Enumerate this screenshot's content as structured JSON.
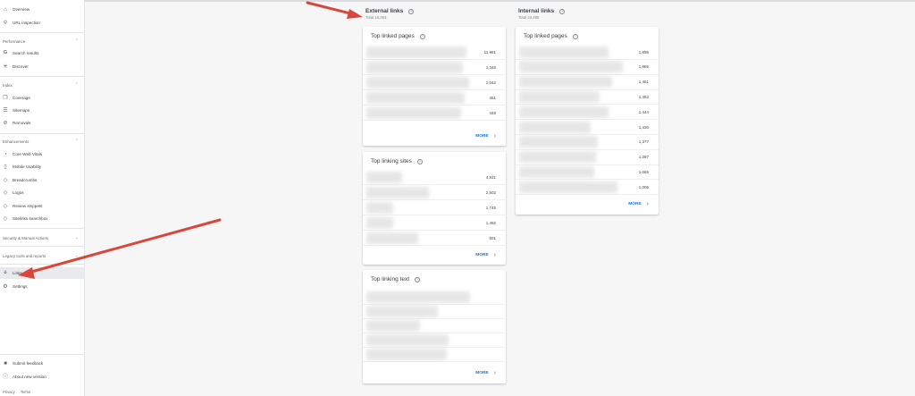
{
  "sidebar": {
    "top_items": [
      {
        "label": "Overview",
        "icon": "home-icon"
      },
      {
        "label": "URL inspection",
        "icon": "search-icon"
      }
    ],
    "sections": {
      "performance": {
        "label": "Performance",
        "items": [
          {
            "label": "Search results",
            "icon": "google-g-icon"
          },
          {
            "label": "Discover",
            "icon": "asterisk-icon"
          }
        ]
      },
      "index": {
        "label": "Index",
        "items": [
          {
            "label": "Coverage",
            "icon": "file-copy-icon"
          },
          {
            "label": "Sitemaps",
            "icon": "sitemap-icon"
          },
          {
            "label": "Removals",
            "icon": "eye-off-icon"
          }
        ]
      },
      "enhancements": {
        "label": "Enhancements",
        "items": [
          {
            "label": "Core Web Vitals",
            "icon": "speed-icon"
          },
          {
            "label": "Mobile Usability",
            "icon": "phone-icon"
          },
          {
            "label": "Breadcrumbs",
            "icon": "diamond-icon"
          },
          {
            "label": "Logos",
            "icon": "diamond-icon"
          },
          {
            "label": "Review snippets",
            "icon": "diamond-icon"
          },
          {
            "label": "Sitelinks searchbox",
            "icon": "diamond-icon"
          }
        ]
      },
      "security": {
        "label": "Security & Manual Actions"
      },
      "legacy": {
        "label": "Legacy tools and reports"
      }
    },
    "bottom_items": [
      {
        "label": "Links",
        "icon": "links-icon"
      },
      {
        "label": "Settings",
        "icon": "gear-icon"
      }
    ],
    "footer_items": [
      {
        "label": "Submit feedback",
        "icon": "feedback-icon"
      },
      {
        "label": "About new version",
        "icon": "info-icon"
      }
    ],
    "footer_links": [
      "Privacy",
      "Terms"
    ]
  },
  "external": {
    "title": "External links",
    "total": "Total 18,353",
    "top_linked_pages": {
      "title": "Top linked pages",
      "values": [
        "11,981",
        "1,346",
        "1,042",
        "451",
        "448"
      ],
      "more": "MORE"
    },
    "top_linking_sites": {
      "title": "Top linking sites",
      "values": [
        "4,931",
        "2,502",
        "1,745",
        "1,492",
        "501"
      ],
      "more": "MORE"
    },
    "top_linking_text": {
      "title": "Top linking text",
      "values": [
        "",
        "",
        "",
        "",
        ""
      ],
      "more": "MORE"
    }
  },
  "internal": {
    "title": "Internal links",
    "total": "Total 34,495",
    "top_linked_pages": {
      "title": "Top linked pages",
      "values": [
        "1,895",
        "1,865",
        "1,461",
        "1,452",
        "1,444",
        "1,430",
        "1,377",
        "1,287",
        "1,065",
        "1,006"
      ],
      "more": "MORE"
    }
  },
  "colors": {
    "accent": "#1a73e8",
    "annotation_arrow": "#d9473a"
  }
}
